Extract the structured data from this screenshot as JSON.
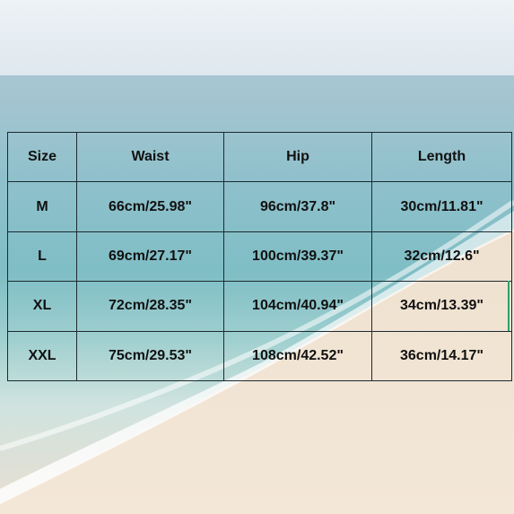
{
  "table": {
    "headers": [
      "Size",
      "Waist",
      "Hip",
      "Length"
    ],
    "rows": [
      [
        "M",
        "66cm/25.98\"",
        "96cm/37.8\"",
        "30cm/11.81\""
      ],
      [
        "L",
        "69cm/27.17\"",
        "100cm/39.37\"",
        "32cm/12.6\""
      ],
      [
        "XL",
        "72cm/28.35\"",
        "104cm/40.94\"",
        "34cm/13.39\""
      ],
      [
        "XXL",
        "75cm/29.53\"",
        "108cm/42.52\"",
        "36cm/14.17\""
      ]
    ]
  },
  "colors": {
    "border": "#1d2a30",
    "text": "#111111",
    "edge_mark": "#2aa36a"
  }
}
